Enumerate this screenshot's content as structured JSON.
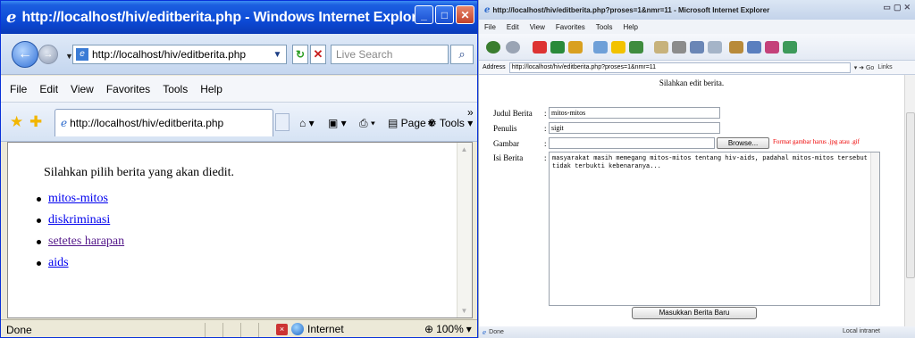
{
  "left_window": {
    "title": "http://localhost/hiv/editberita.php - Windows Internet Explorer",
    "address": "http://localhost/hiv/editberita.php",
    "search_placeholder": "Live Search",
    "menu": [
      "File",
      "Edit",
      "View",
      "Favorites",
      "Tools",
      "Help"
    ],
    "tab_label": "http://localhost/hiv/editberita.php",
    "toolbar": {
      "page_label": "Page",
      "tools_label": "Tools"
    },
    "intro": "Silahkan pilih berita yang akan diedit.",
    "links": [
      {
        "label": "mitos-mitos",
        "visited": false
      },
      {
        "label": "diskriminasi",
        "visited": false
      },
      {
        "label": "setetes harapan",
        "visited": true
      },
      {
        "label": "aids",
        "visited": false
      }
    ],
    "status": {
      "text": "Done",
      "zone": "Internet",
      "zoom": "100%"
    }
  },
  "right_window": {
    "title": "http://localhost/hiv/editberita.php?proses=1&nmr=11 - Microsoft Internet Explorer",
    "menu": [
      "File",
      "Edit",
      "View",
      "Favorites",
      "Tools",
      "Help"
    ],
    "address_label": "Address",
    "address": "http://localhost/hiv/editberita.php?proses=1&nmr=11",
    "go_label": "Go",
    "links_label": "Links",
    "heading": "Silahkan edit berita.",
    "form": {
      "judul_label": "Judul Berita",
      "judul_value": "mitos-mitos",
      "penulis_label": "Penulis",
      "penulis_value": "sigit",
      "gambar_label": "Gambar",
      "browse_label": "Browse...",
      "gambar_warning": "Format gambar harus .jpg atau .gif",
      "isi_label": "Isi Berita",
      "isi_value": "masyarakat masih memegang mitos-mitos tentang hiv-aids, padahal mitos-mitos tersebut tidak terbukti kebenaranya...",
      "submit_label": "Masukkan Berita Baru"
    },
    "status": {
      "text": "Done",
      "zone": "Local intranet"
    }
  }
}
